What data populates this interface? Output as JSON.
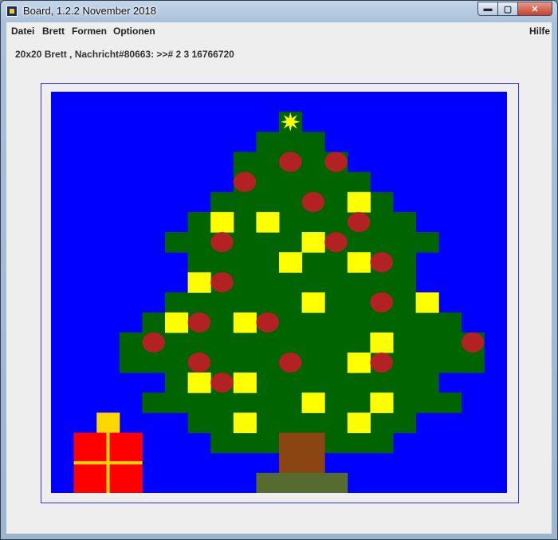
{
  "window": {
    "title": "Board, 1.2.2 November 2018"
  },
  "menu": {
    "items": [
      "Datei",
      "Brett",
      "Formen",
      "Optionen"
    ],
    "help": "Hilfe"
  },
  "status_text": "20x20 Brett , Nachricht#80663: >># 2 3 16766720",
  "board": {
    "grid_size": 20,
    "colors": {
      "background": "#0000ff",
      "tree": "#006400",
      "ornament": "#b22222",
      "light": "#ffff00",
      "star": "#ffff00",
      "trunk": "#8b4513",
      "pot": "#556b2f",
      "gift_box": "#ff0000",
      "gift_top": "#ffd700",
      "gift_ribbon": "#ffd700"
    }
  }
}
